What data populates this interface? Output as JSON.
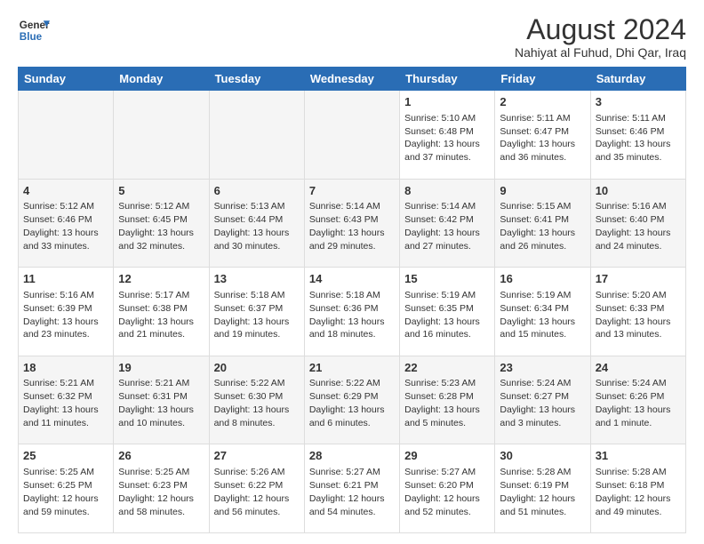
{
  "header": {
    "logo_line1": "General",
    "logo_line2": "Blue",
    "title": "August 2024",
    "subtitle": "Nahiyat al Fuhud, Dhi Qar, Iraq"
  },
  "calendar": {
    "days_of_week": [
      "Sunday",
      "Monday",
      "Tuesday",
      "Wednesday",
      "Thursday",
      "Friday",
      "Saturday"
    ],
    "weeks": [
      [
        {
          "day": "",
          "info": ""
        },
        {
          "day": "",
          "info": ""
        },
        {
          "day": "",
          "info": ""
        },
        {
          "day": "",
          "info": ""
        },
        {
          "day": "1",
          "info": "Sunrise: 5:10 AM\nSunset: 6:48 PM\nDaylight: 13 hours and 37 minutes."
        },
        {
          "day": "2",
          "info": "Sunrise: 5:11 AM\nSunset: 6:47 PM\nDaylight: 13 hours and 36 minutes."
        },
        {
          "day": "3",
          "info": "Sunrise: 5:11 AM\nSunset: 6:46 PM\nDaylight: 13 hours and 35 minutes."
        }
      ],
      [
        {
          "day": "4",
          "info": "Sunrise: 5:12 AM\nSunset: 6:46 PM\nDaylight: 13 hours and 33 minutes."
        },
        {
          "day": "5",
          "info": "Sunrise: 5:12 AM\nSunset: 6:45 PM\nDaylight: 13 hours and 32 minutes."
        },
        {
          "day": "6",
          "info": "Sunrise: 5:13 AM\nSunset: 6:44 PM\nDaylight: 13 hours and 30 minutes."
        },
        {
          "day": "7",
          "info": "Sunrise: 5:14 AM\nSunset: 6:43 PM\nDaylight: 13 hours and 29 minutes."
        },
        {
          "day": "8",
          "info": "Sunrise: 5:14 AM\nSunset: 6:42 PM\nDaylight: 13 hours and 27 minutes."
        },
        {
          "day": "9",
          "info": "Sunrise: 5:15 AM\nSunset: 6:41 PM\nDaylight: 13 hours and 26 minutes."
        },
        {
          "day": "10",
          "info": "Sunrise: 5:16 AM\nSunset: 6:40 PM\nDaylight: 13 hours and 24 minutes."
        }
      ],
      [
        {
          "day": "11",
          "info": "Sunrise: 5:16 AM\nSunset: 6:39 PM\nDaylight: 13 hours and 23 minutes."
        },
        {
          "day": "12",
          "info": "Sunrise: 5:17 AM\nSunset: 6:38 PM\nDaylight: 13 hours and 21 minutes."
        },
        {
          "day": "13",
          "info": "Sunrise: 5:18 AM\nSunset: 6:37 PM\nDaylight: 13 hours and 19 minutes."
        },
        {
          "day": "14",
          "info": "Sunrise: 5:18 AM\nSunset: 6:36 PM\nDaylight: 13 hours and 18 minutes."
        },
        {
          "day": "15",
          "info": "Sunrise: 5:19 AM\nSunset: 6:35 PM\nDaylight: 13 hours and 16 minutes."
        },
        {
          "day": "16",
          "info": "Sunrise: 5:19 AM\nSunset: 6:34 PM\nDaylight: 13 hours and 15 minutes."
        },
        {
          "day": "17",
          "info": "Sunrise: 5:20 AM\nSunset: 6:33 PM\nDaylight: 13 hours and 13 minutes."
        }
      ],
      [
        {
          "day": "18",
          "info": "Sunrise: 5:21 AM\nSunset: 6:32 PM\nDaylight: 13 hours and 11 minutes."
        },
        {
          "day": "19",
          "info": "Sunrise: 5:21 AM\nSunset: 6:31 PM\nDaylight: 13 hours and 10 minutes."
        },
        {
          "day": "20",
          "info": "Sunrise: 5:22 AM\nSunset: 6:30 PM\nDaylight: 13 hours and 8 minutes."
        },
        {
          "day": "21",
          "info": "Sunrise: 5:22 AM\nSunset: 6:29 PM\nDaylight: 13 hours and 6 minutes."
        },
        {
          "day": "22",
          "info": "Sunrise: 5:23 AM\nSunset: 6:28 PM\nDaylight: 13 hours and 5 minutes."
        },
        {
          "day": "23",
          "info": "Sunrise: 5:24 AM\nSunset: 6:27 PM\nDaylight: 13 hours and 3 minutes."
        },
        {
          "day": "24",
          "info": "Sunrise: 5:24 AM\nSunset: 6:26 PM\nDaylight: 13 hours and 1 minute."
        }
      ],
      [
        {
          "day": "25",
          "info": "Sunrise: 5:25 AM\nSunset: 6:25 PM\nDaylight: 12 hours and 59 minutes."
        },
        {
          "day": "26",
          "info": "Sunrise: 5:25 AM\nSunset: 6:23 PM\nDaylight: 12 hours and 58 minutes."
        },
        {
          "day": "27",
          "info": "Sunrise: 5:26 AM\nSunset: 6:22 PM\nDaylight: 12 hours and 56 minutes."
        },
        {
          "day": "28",
          "info": "Sunrise: 5:27 AM\nSunset: 6:21 PM\nDaylight: 12 hours and 54 minutes."
        },
        {
          "day": "29",
          "info": "Sunrise: 5:27 AM\nSunset: 6:20 PM\nDaylight: 12 hours and 52 minutes."
        },
        {
          "day": "30",
          "info": "Sunrise: 5:28 AM\nSunset: 6:19 PM\nDaylight: 12 hours and 51 minutes."
        },
        {
          "day": "31",
          "info": "Sunrise: 5:28 AM\nSunset: 6:18 PM\nDaylight: 12 hours and 49 minutes."
        }
      ]
    ]
  }
}
